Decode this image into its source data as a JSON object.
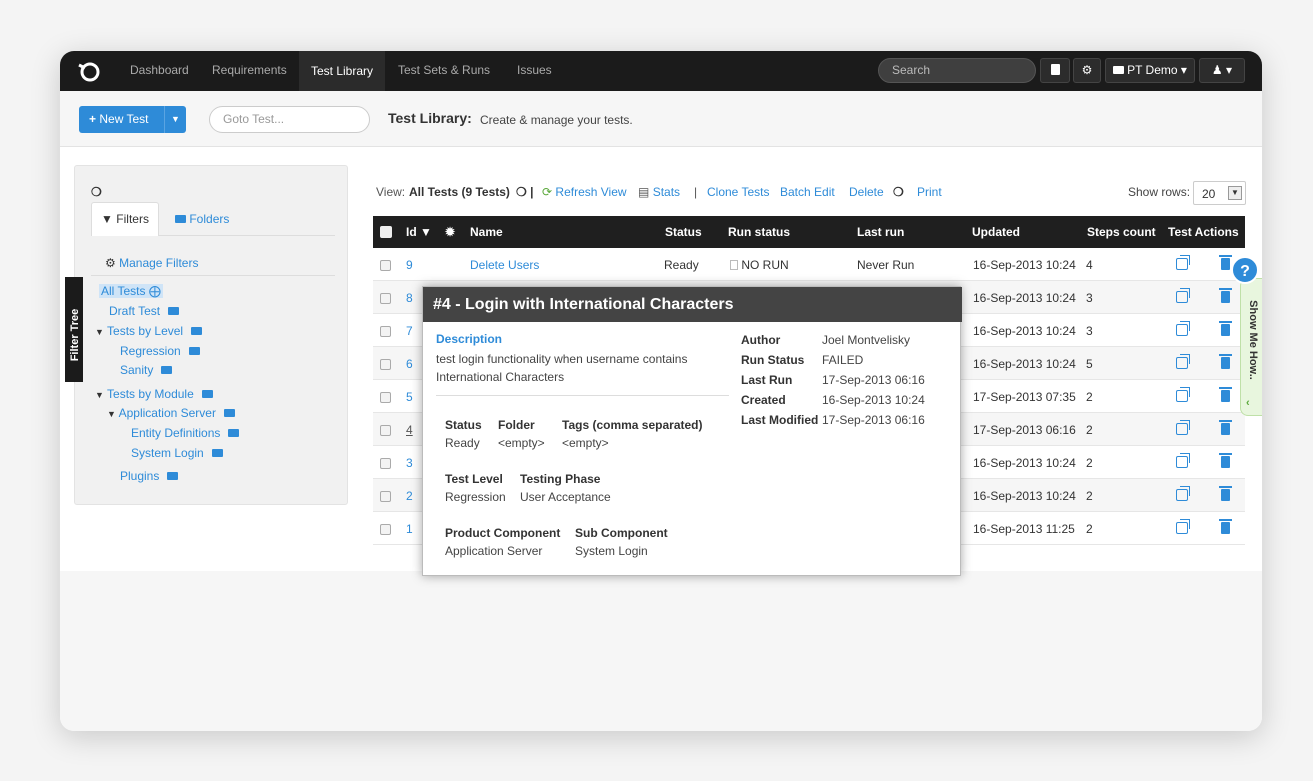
{
  "nav": {
    "items": [
      "Dashboard",
      "Requirements",
      "Test Library",
      "Test Sets & Runs",
      "Issues"
    ],
    "active": "Test Library",
    "search_placeholder": "Search",
    "project": "PT Demo",
    "project_caret": "▾",
    "user_caret": "▾"
  },
  "toolbar": {
    "new_test_label": "New Test",
    "goto_placeholder": "Goto Test...",
    "title": "Test Library:",
    "subtitle": "Create & manage your tests."
  },
  "left": {
    "tab_filters": "Filters",
    "tab_folders": "Folders",
    "manage_filters": "Manage Filters",
    "filter_tree_tab": "Filter Tree",
    "tree": [
      {
        "label": "All Tests"
      },
      {
        "label": "Draft Test"
      },
      {
        "label": "Tests by Level"
      },
      {
        "label": "Regression"
      },
      {
        "label": "Sanity"
      },
      {
        "label": "Tests by Module"
      },
      {
        "label": "Application Server"
      },
      {
        "label": "Entity Definitions"
      },
      {
        "label": "System Login"
      },
      {
        "label": "Plugins"
      }
    ]
  },
  "view": {
    "view_label": "View:",
    "view_name": "All Tests (9 Tests)",
    "refresh": "Refresh View",
    "stats": "Stats",
    "clone": "Clone Tests",
    "batch_edit": "Batch Edit",
    "delete": "Delete",
    "print": "Print",
    "show_rows_label": "Show rows:",
    "show_rows_value": "20"
  },
  "table": {
    "headers": {
      "id": "Id",
      "name": "Name",
      "status": "Status",
      "run_status": "Run status",
      "last_run": "Last run",
      "updated": "Updated",
      "steps": "Steps count",
      "actions": "Test Actions"
    },
    "rows": [
      {
        "id": "9",
        "name": "Delete Users",
        "status": "Ready",
        "run_status": "NO RUN",
        "last_run": "Never Run",
        "updated": "16-Sep-2013 10:24",
        "steps": "4"
      },
      {
        "id": "8",
        "updated": "16-Sep-2013 10:24",
        "steps": "3"
      },
      {
        "id": "7",
        "updated": "16-Sep-2013 10:24",
        "steps": "3"
      },
      {
        "id": "6",
        "updated": "16-Sep-2013 10:24",
        "steps": "5"
      },
      {
        "id": "5",
        "updated": "17-Sep-2013 07:35",
        "steps": "2"
      },
      {
        "id": "4",
        "updated": "17-Sep-2013 06:16",
        "steps": "2"
      },
      {
        "id": "3",
        "updated": "16-Sep-2013 10:24",
        "steps": "2"
      },
      {
        "id": "2",
        "updated": "16-Sep-2013 10:24",
        "steps": "2"
      },
      {
        "id": "1",
        "updated": "16-Sep-2013 11:25",
        "steps": "2"
      }
    ]
  },
  "popup": {
    "title": "#4 - Login with International Characters",
    "desc_label": "Description",
    "desc": "test login functionality when username contains International Characters",
    "status_label": "Status",
    "status": "Ready",
    "folder_label": "Folder",
    "folder": "<empty>",
    "tags_label": "Tags (comma separated)",
    "tags": "<empty>",
    "level_label": "Test Level",
    "level": "Regression",
    "phase_label": "Testing Phase",
    "phase": "User Acceptance",
    "component_label": "Product Component",
    "component": "Application Server",
    "subcomponent_label": "Sub Component",
    "subcomponent": "System Login",
    "author_label": "Author",
    "author": "Joel Montvelisky",
    "run_status_label": "Run Status",
    "run_status": "FAILED",
    "last_run_label": "Last Run",
    "last_run": "17-Sep-2013 06:16",
    "created_label": "Created",
    "created": "16-Sep-2013 10:24",
    "modified_label": "Last Modified",
    "modified": "17-Sep-2013 06:16"
  },
  "side": {
    "show_me_how": "Show Me How..",
    "help": "?"
  },
  "colors": {
    "accent": "#2e8bd8",
    "nav_bg": "#1b1b1b"
  }
}
